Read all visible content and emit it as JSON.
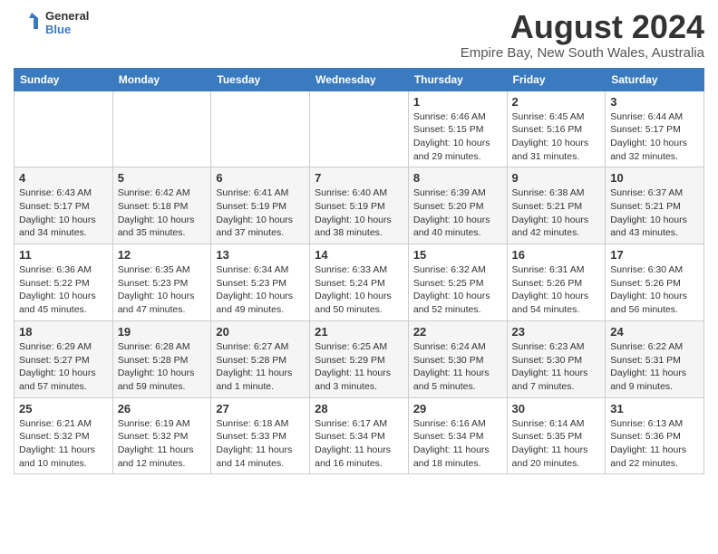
{
  "header": {
    "logo_line1": "General",
    "logo_line2": "Blue",
    "month_year": "August 2024",
    "location": "Empire Bay, New South Wales, Australia"
  },
  "weekdays": [
    "Sunday",
    "Monday",
    "Tuesday",
    "Wednesday",
    "Thursday",
    "Friday",
    "Saturday"
  ],
  "weeks": [
    [
      {
        "day": "",
        "sunrise": "",
        "sunset": "",
        "daylight": ""
      },
      {
        "day": "",
        "sunrise": "",
        "sunset": "",
        "daylight": ""
      },
      {
        "day": "",
        "sunrise": "",
        "sunset": "",
        "daylight": ""
      },
      {
        "day": "",
        "sunrise": "",
        "sunset": "",
        "daylight": ""
      },
      {
        "day": "1",
        "sunrise": "Sunrise: 6:46 AM",
        "sunset": "Sunset: 5:15 PM",
        "daylight": "Daylight: 10 hours and 29 minutes."
      },
      {
        "day": "2",
        "sunrise": "Sunrise: 6:45 AM",
        "sunset": "Sunset: 5:16 PM",
        "daylight": "Daylight: 10 hours and 31 minutes."
      },
      {
        "day": "3",
        "sunrise": "Sunrise: 6:44 AM",
        "sunset": "Sunset: 5:17 PM",
        "daylight": "Daylight: 10 hours and 32 minutes."
      }
    ],
    [
      {
        "day": "4",
        "sunrise": "Sunrise: 6:43 AM",
        "sunset": "Sunset: 5:17 PM",
        "daylight": "Daylight: 10 hours and 34 minutes."
      },
      {
        "day": "5",
        "sunrise": "Sunrise: 6:42 AM",
        "sunset": "Sunset: 5:18 PM",
        "daylight": "Daylight: 10 hours and 35 minutes."
      },
      {
        "day": "6",
        "sunrise": "Sunrise: 6:41 AM",
        "sunset": "Sunset: 5:19 PM",
        "daylight": "Daylight: 10 hours and 37 minutes."
      },
      {
        "day": "7",
        "sunrise": "Sunrise: 6:40 AM",
        "sunset": "Sunset: 5:19 PM",
        "daylight": "Daylight: 10 hours and 38 minutes."
      },
      {
        "day": "8",
        "sunrise": "Sunrise: 6:39 AM",
        "sunset": "Sunset: 5:20 PM",
        "daylight": "Daylight: 10 hours and 40 minutes."
      },
      {
        "day": "9",
        "sunrise": "Sunrise: 6:38 AM",
        "sunset": "Sunset: 5:21 PM",
        "daylight": "Daylight: 10 hours and 42 minutes."
      },
      {
        "day": "10",
        "sunrise": "Sunrise: 6:37 AM",
        "sunset": "Sunset: 5:21 PM",
        "daylight": "Daylight: 10 hours and 43 minutes."
      }
    ],
    [
      {
        "day": "11",
        "sunrise": "Sunrise: 6:36 AM",
        "sunset": "Sunset: 5:22 PM",
        "daylight": "Daylight: 10 hours and 45 minutes."
      },
      {
        "day": "12",
        "sunrise": "Sunrise: 6:35 AM",
        "sunset": "Sunset: 5:23 PM",
        "daylight": "Daylight: 10 hours and 47 minutes."
      },
      {
        "day": "13",
        "sunrise": "Sunrise: 6:34 AM",
        "sunset": "Sunset: 5:23 PM",
        "daylight": "Daylight: 10 hours and 49 minutes."
      },
      {
        "day": "14",
        "sunrise": "Sunrise: 6:33 AM",
        "sunset": "Sunset: 5:24 PM",
        "daylight": "Daylight: 10 hours and 50 minutes."
      },
      {
        "day": "15",
        "sunrise": "Sunrise: 6:32 AM",
        "sunset": "Sunset: 5:25 PM",
        "daylight": "Daylight: 10 hours and 52 minutes."
      },
      {
        "day": "16",
        "sunrise": "Sunrise: 6:31 AM",
        "sunset": "Sunset: 5:26 PM",
        "daylight": "Daylight: 10 hours and 54 minutes."
      },
      {
        "day": "17",
        "sunrise": "Sunrise: 6:30 AM",
        "sunset": "Sunset: 5:26 PM",
        "daylight": "Daylight: 10 hours and 56 minutes."
      }
    ],
    [
      {
        "day": "18",
        "sunrise": "Sunrise: 6:29 AM",
        "sunset": "Sunset: 5:27 PM",
        "daylight": "Daylight: 10 hours and 57 minutes."
      },
      {
        "day": "19",
        "sunrise": "Sunrise: 6:28 AM",
        "sunset": "Sunset: 5:28 PM",
        "daylight": "Daylight: 10 hours and 59 minutes."
      },
      {
        "day": "20",
        "sunrise": "Sunrise: 6:27 AM",
        "sunset": "Sunset: 5:28 PM",
        "daylight": "Daylight: 11 hours and 1 minute."
      },
      {
        "day": "21",
        "sunrise": "Sunrise: 6:25 AM",
        "sunset": "Sunset: 5:29 PM",
        "daylight": "Daylight: 11 hours and 3 minutes."
      },
      {
        "day": "22",
        "sunrise": "Sunrise: 6:24 AM",
        "sunset": "Sunset: 5:30 PM",
        "daylight": "Daylight: 11 hours and 5 minutes."
      },
      {
        "day": "23",
        "sunrise": "Sunrise: 6:23 AM",
        "sunset": "Sunset: 5:30 PM",
        "daylight": "Daylight: 11 hours and 7 minutes."
      },
      {
        "day": "24",
        "sunrise": "Sunrise: 6:22 AM",
        "sunset": "Sunset: 5:31 PM",
        "daylight": "Daylight: 11 hours and 9 minutes."
      }
    ],
    [
      {
        "day": "25",
        "sunrise": "Sunrise: 6:21 AM",
        "sunset": "Sunset: 5:32 PM",
        "daylight": "Daylight: 11 hours and 10 minutes."
      },
      {
        "day": "26",
        "sunrise": "Sunrise: 6:19 AM",
        "sunset": "Sunset: 5:32 PM",
        "daylight": "Daylight: 11 hours and 12 minutes."
      },
      {
        "day": "27",
        "sunrise": "Sunrise: 6:18 AM",
        "sunset": "Sunset: 5:33 PM",
        "daylight": "Daylight: 11 hours and 14 minutes."
      },
      {
        "day": "28",
        "sunrise": "Sunrise: 6:17 AM",
        "sunset": "Sunset: 5:34 PM",
        "daylight": "Daylight: 11 hours and 16 minutes."
      },
      {
        "day": "29",
        "sunrise": "Sunrise: 6:16 AM",
        "sunset": "Sunset: 5:34 PM",
        "daylight": "Daylight: 11 hours and 18 minutes."
      },
      {
        "day": "30",
        "sunrise": "Sunrise: 6:14 AM",
        "sunset": "Sunset: 5:35 PM",
        "daylight": "Daylight: 11 hours and 20 minutes."
      },
      {
        "day": "31",
        "sunrise": "Sunrise: 6:13 AM",
        "sunset": "Sunset: 5:36 PM",
        "daylight": "Daylight: 11 hours and 22 minutes."
      }
    ]
  ]
}
